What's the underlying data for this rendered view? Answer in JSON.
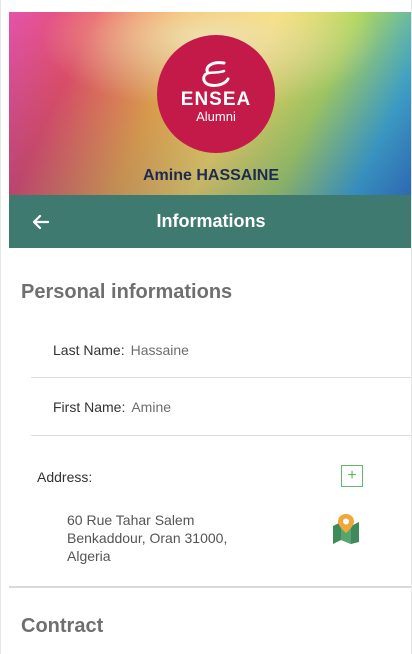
{
  "header": {
    "logo_name": "ENSEA",
    "logo_sub": "Alumni",
    "user_name": "Amine HASSAINE"
  },
  "toolbar": {
    "back_icon": "arrow-left-icon",
    "title": "Informations"
  },
  "personal": {
    "section_title": "Personal informations",
    "last_name_label": "Last Name:",
    "last_name_value": "Hassaine",
    "first_name_label": "First Name:",
    "first_name_value": "Amine",
    "address_label": "Address:",
    "add_icon": "plus-icon",
    "address_line1": "60 Rue Tahar Salem",
    "address_line2": "Benkaddour, Oran 31000,",
    "address_line3": "Algeria",
    "map_icon": "map-pin-icon"
  },
  "contract": {
    "section_title": "Contract"
  },
  "colors": {
    "toolbar": "#3f7a71",
    "logo": "#c41a4a",
    "accent_green": "#5dbb63"
  }
}
